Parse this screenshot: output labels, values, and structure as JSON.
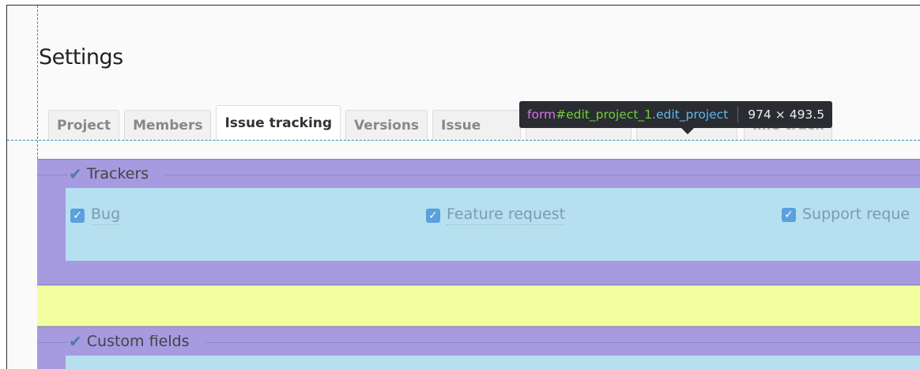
{
  "page": {
    "title": "Settings"
  },
  "tabs": [
    {
      "label": "Project",
      "selected": false
    },
    {
      "label": "Members",
      "selected": false
    },
    {
      "label": "Issue tracking",
      "selected": true
    },
    {
      "label": "Versions",
      "selected": false
    },
    {
      "label": "Issue",
      "selected": false
    },
    {
      "label": "ime track",
      "selected": false
    }
  ],
  "inspector_tooltip": {
    "tag": "form",
    "id": "#edit_project_1",
    "class": ".edit_project",
    "dimensions": "974 × 493.5"
  },
  "trackers": {
    "legend": "Trackers",
    "items": [
      {
        "label": "Bug",
        "checked": true
      },
      {
        "label": "Feature request",
        "checked": true
      },
      {
        "label": "Support reque",
        "checked": true
      }
    ]
  },
  "custom_fields": {
    "legend": "Custom fields"
  },
  "colors": {
    "margin": "#a69ae0",
    "padding": "#b6e0f0",
    "gap": "#f3ff9e",
    "guide": "#2b8fc2"
  },
  "icons": {
    "legend_check": "check-icon",
    "checkbox": "checkbox-checked-icon"
  }
}
